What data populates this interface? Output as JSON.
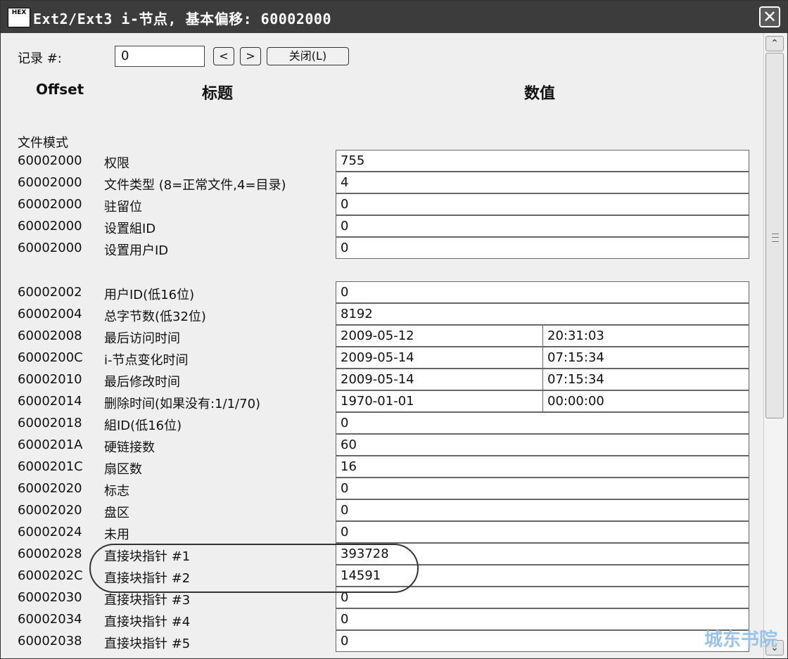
{
  "window": {
    "title": "Ext2/Ext3 i-节点, 基本偏移: 60002000",
    "icon_text": "HEX"
  },
  "controls": {
    "record_label": "记录 #:",
    "record_value": "0",
    "prev_label": "<",
    "next_label": ">",
    "close_label": "关闭(L)"
  },
  "headers": {
    "offset": "Offset",
    "title": "标题",
    "value": "数值"
  },
  "section_label": "文件模式",
  "rows": [
    {
      "offset": "60002000",
      "title": "权限",
      "value": "755"
    },
    {
      "offset": "60002000",
      "title": "文件类型 (8=正常文件,4=目录)",
      "value": "4"
    },
    {
      "offset": "60002000",
      "title": "驻留位",
      "value": "0"
    },
    {
      "offset": "60002000",
      "title": "设置組ID",
      "value": "0"
    },
    {
      "offset": "60002000",
      "title": "设置用户ID",
      "value": "0"
    },
    {
      "offset": "60002002",
      "title": "用户ID(低16位)",
      "value": "0"
    },
    {
      "offset": "60002004",
      "title": "总字节数(低32位)",
      "value": "8192"
    },
    {
      "offset": "60002008",
      "title": "最后访问时间",
      "value": "2009-05-12",
      "value2": "20:31:03"
    },
    {
      "offset": "6000200C",
      "title": "i-节点变化时间",
      "value": "2009-05-14",
      "value2": "07:15:34"
    },
    {
      "offset": "60002010",
      "title": "最后修改时间",
      "value": "2009-05-14",
      "value2": "07:15:34"
    },
    {
      "offset": "60002014",
      "title": "删除时间(如果没有:1/1/70)",
      "value": "1970-01-01",
      "value2": "00:00:00"
    },
    {
      "offset": "60002018",
      "title": "組ID(低16位)",
      "value": "0"
    },
    {
      "offset": "6000201A",
      "title": "硬链接数",
      "value": "60"
    },
    {
      "offset": "6000201C",
      "title": "扇区数",
      "value": "16"
    },
    {
      "offset": "60002020",
      "title": "标志",
      "value": "0"
    },
    {
      "offset": "60002020",
      "title": "盘区",
      "value": "0"
    },
    {
      "offset": "60002024",
      "title": "未用",
      "value": "0"
    },
    {
      "offset": "60002028",
      "title": "直接块指针 #1",
      "value": "393728"
    },
    {
      "offset": "6000202C",
      "title": "直接块指针 #2",
      "value": "14591"
    },
    {
      "offset": "60002030",
      "title": "直接块指针 #3",
      "value": "0"
    },
    {
      "offset": "60002034",
      "title": "直接块指针 #4",
      "value": "0"
    },
    {
      "offset": "60002038",
      "title": "直接块指针 #5",
      "value": "0"
    }
  ],
  "watermark": "城东书院"
}
